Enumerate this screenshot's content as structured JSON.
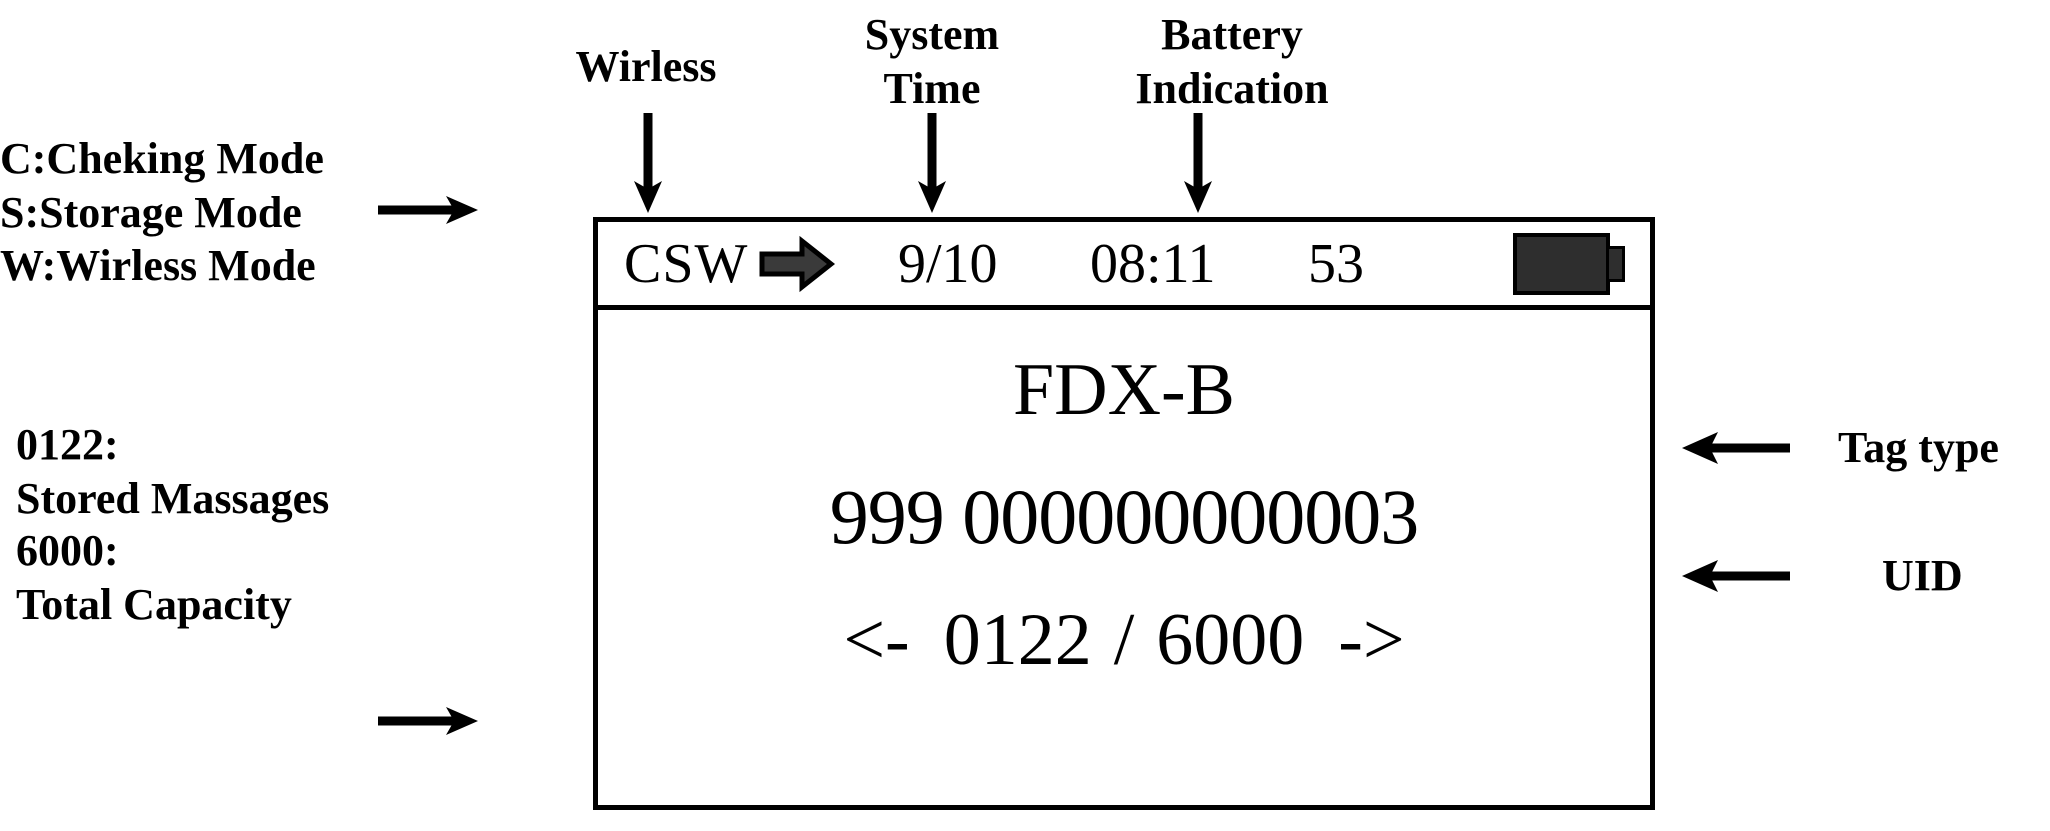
{
  "annotations": {
    "mode_legend": "C:Cheking Mode\nS:Storage Mode\nW:Wirless Mode",
    "wireless_label": "Wirless",
    "system_time_label": "System\nTime",
    "battery_label": "Battery\nIndication",
    "tag_type_label": "Tag type",
    "uid_label": "UID",
    "stored_messages_label": "0122:\nStored Massages",
    "total_capacity_label": "6000:\nTotal Capacity"
  },
  "device": {
    "status_bar": {
      "mode": "CSW",
      "wireless_icon": "arrow-right-icon",
      "date": "9/10",
      "time": "08:11",
      "count": "53",
      "battery_icon": "battery-full-icon"
    },
    "display": {
      "tag_type": "FDX-B",
      "uid_country_code": "999",
      "uid_national_code": "000000000003",
      "uid_full": "999  000000000003",
      "pager_prev": "<-",
      "pager_current": "0122",
      "pager_separator": "/",
      "pager_total": "6000",
      "pager_next": "->",
      "pager_line": "<-  0122  /  6000  ->"
    }
  },
  "colors": {
    "ink": "#000000",
    "background": "#ffffff",
    "icon_fill": "#2e2e2e"
  }
}
